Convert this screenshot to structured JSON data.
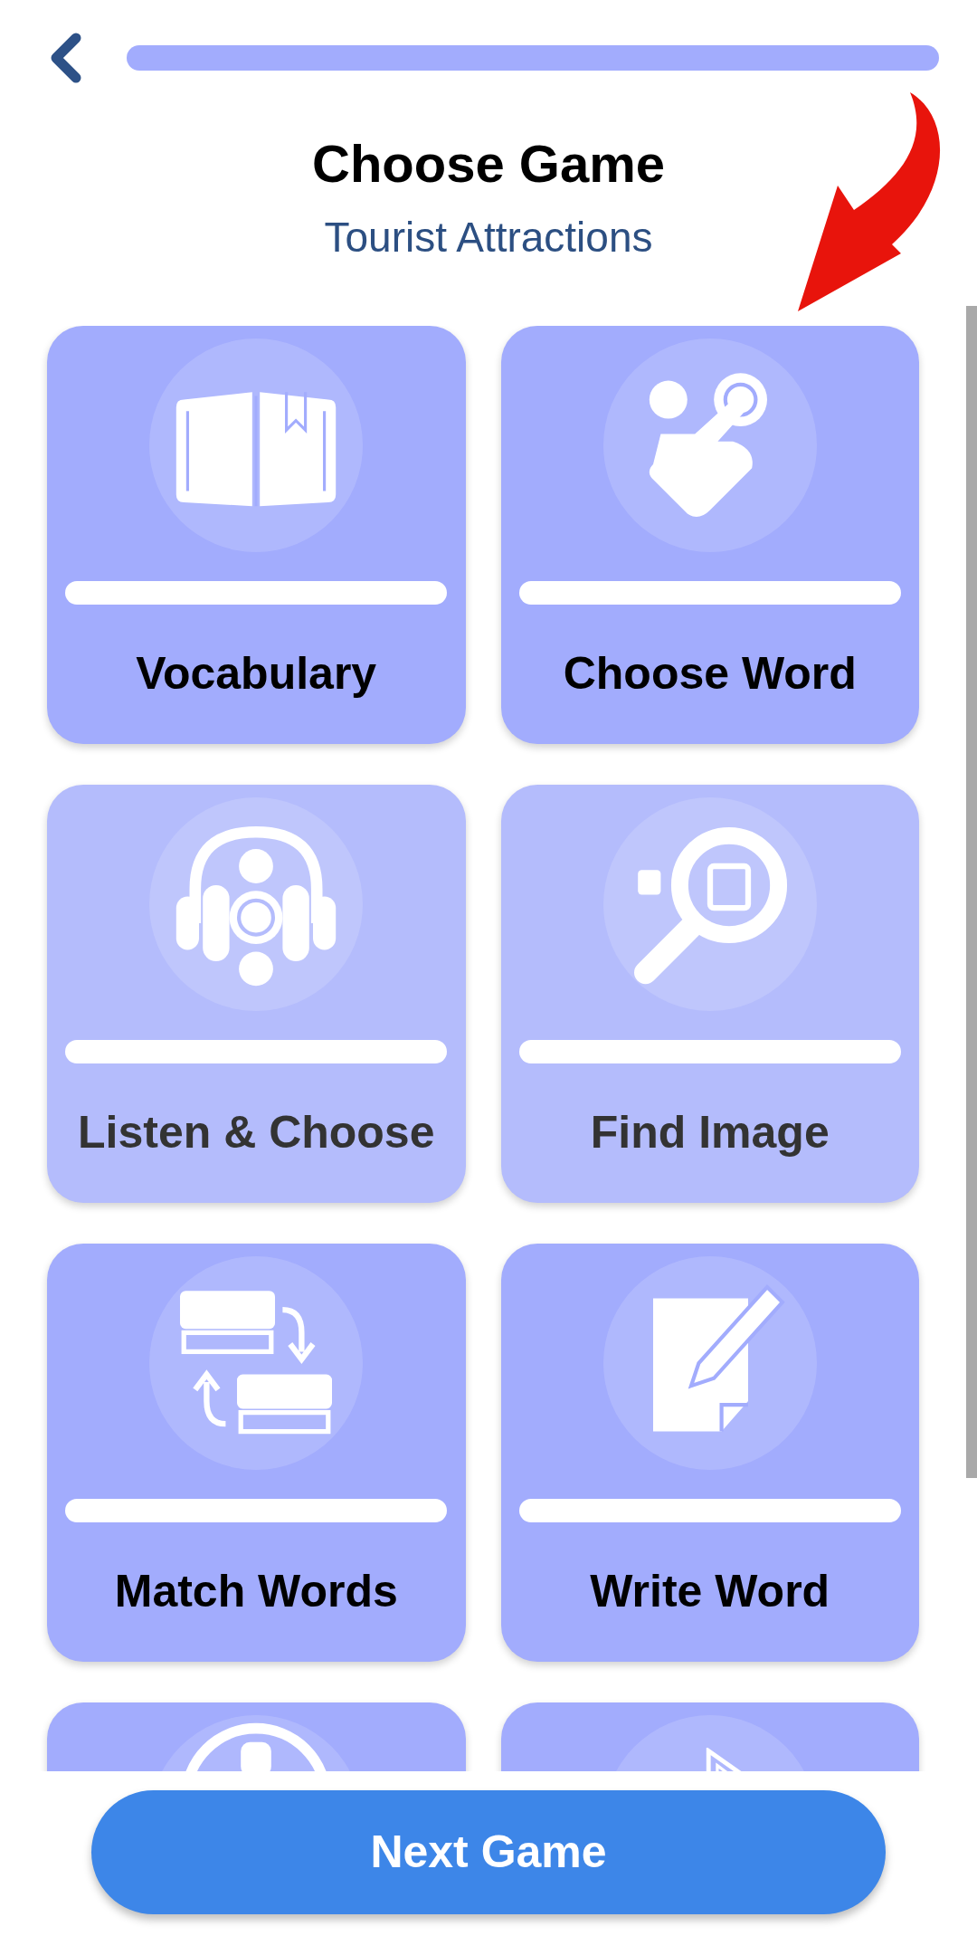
{
  "header": {
    "title": "Choose Game",
    "subtitle": "Tourist Attractions"
  },
  "games": [
    {
      "kind": "book",
      "label": "Vocabulary",
      "disabled": false
    },
    {
      "kind": "tap",
      "label": "Choose Word",
      "disabled": false
    },
    {
      "kind": "headphones",
      "label": "Listen & Choose",
      "disabled": true
    },
    {
      "kind": "search",
      "label": "Find Image",
      "disabled": true
    },
    {
      "kind": "swap",
      "label": "Match Words",
      "disabled": false
    },
    {
      "kind": "write",
      "label": "Write Word",
      "disabled": false
    },
    {
      "kind": "ring",
      "disabled": false
    },
    {
      "kind": "pen",
      "disabled": false
    }
  ],
  "next_button": {
    "label": "Next Game"
  }
}
